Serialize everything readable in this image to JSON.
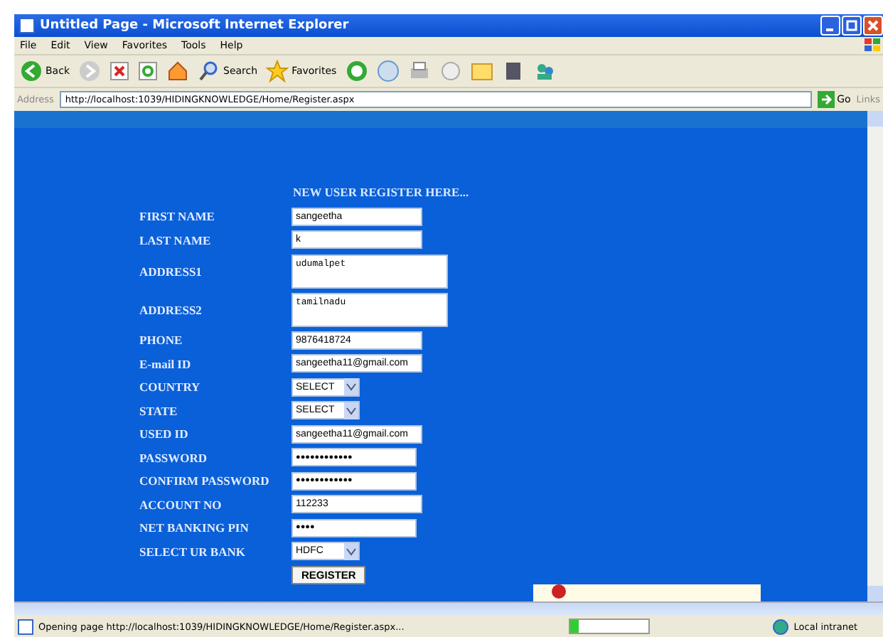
{
  "window": {
    "title": "Untitled Page - Microsoft Internet Explorer"
  },
  "menu": [
    "File",
    "Edit",
    "View",
    "Favorites",
    "Tools",
    "Help"
  ],
  "toolbar": {
    "back": "Back",
    "search": "Search",
    "favorites": "Favorites"
  },
  "address_bar": {
    "label": "Address",
    "url": "http://localhost:1039/HIDINGKNOWLEDGE/Home/Register.aspx",
    "go": "Go",
    "links": "Links"
  },
  "form": {
    "heading": "NEW USER REGISTER HERE...",
    "fields": [
      {
        "label": "FIRST NAME",
        "kind": "text",
        "value": "sangeetha"
      },
      {
        "label": "LAST NAME",
        "kind": "text",
        "value": "k"
      },
      {
        "label": "ADDRESS1",
        "kind": "textarea",
        "value": "udumalpet"
      },
      {
        "label": "ADDRESS2",
        "kind": "textarea",
        "value": "tamilnadu"
      },
      {
        "label": "PHONE",
        "kind": "text",
        "value": "9876418724"
      },
      {
        "label": "E-mail ID",
        "kind": "text",
        "value": "sangeetha11@gmail.com"
      },
      {
        "label": "COUNTRY",
        "kind": "select",
        "value": "SELECT"
      },
      {
        "label": "STATE",
        "kind": "select",
        "value": "SELECT"
      },
      {
        "label": "USED ID",
        "kind": "text",
        "value": "sangeetha11@gmail.com"
      },
      {
        "label": "PASSWORD",
        "kind": "password",
        "value": "●●●●●●●●●●●●"
      },
      {
        "label": "CONFIRM PASSWORD",
        "kind": "password",
        "value": "●●●●●●●●●●●●"
      },
      {
        "label": "ACCOUNT NO",
        "kind": "text",
        "value": "112233"
      },
      {
        "label": "NET BANKING PIN",
        "kind": "password",
        "value": "●●●●"
      },
      {
        "label": "SELECT UR BANK",
        "kind": "select",
        "value": "HDFC"
      }
    ],
    "submit": "REGISTER"
  },
  "status_bar": {
    "text": "Opening page http://localhost:1039/HIDINGKNOWLEDGE/Home/Register.aspx...",
    "level": 0.1,
    "zone": "Local intranet"
  }
}
